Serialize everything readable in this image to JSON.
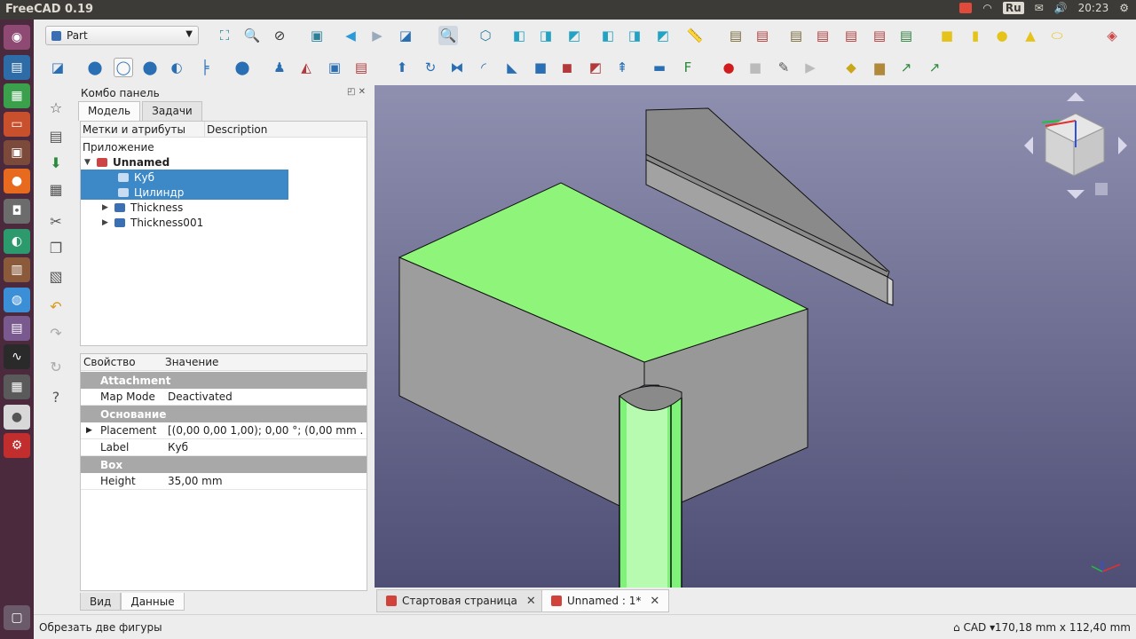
{
  "window": {
    "title": "FreeCAD 0.19",
    "time": "20:23",
    "keyboard": "Ru"
  },
  "workbench": {
    "selected": "Part"
  },
  "combo": {
    "title": "Комбо панель",
    "tabs": [
      "Модель",
      "Задачи"
    ],
    "tree_headers": [
      "Метки и атрибуты",
      "Description"
    ],
    "root_label": "Приложение",
    "document": "Unnamed",
    "items": [
      {
        "label": "Куб",
        "selected": true
      },
      {
        "label": "Цилиндр",
        "selected": true
      },
      {
        "label": "Thickness",
        "selected": false
      },
      {
        "label": "Thickness001",
        "selected": false
      }
    ],
    "prop_headers": [
      "Свойство",
      "Значение"
    ],
    "props": [
      {
        "type": "group",
        "name": "Attachment"
      },
      {
        "type": "prop",
        "name": "Map Mode",
        "value": "Deactivated"
      },
      {
        "type": "group",
        "name": "Основание"
      },
      {
        "type": "prop",
        "name": "Placement",
        "value": "[(0,00 0,00 1,00); 0,00 °; (0,00 mm  ..."
      },
      {
        "type": "prop",
        "name": "Label",
        "value": "Куб"
      },
      {
        "type": "group",
        "name": "Box"
      },
      {
        "type": "prop",
        "name": "Height",
        "value": "35,00 mm"
      }
    ],
    "bottom_tabs": [
      "Вид",
      "Данные"
    ]
  },
  "doc_tabs": [
    {
      "label": "Стартовая страница",
      "active": false
    },
    {
      "label": "Unnamed : 1*",
      "active": true
    }
  ],
  "status": {
    "message": "Обрезать две фигуры",
    "nav_style": "CAD",
    "dimensions": "170,18 mm x 112,40 mm"
  },
  "colors": {
    "selection": "#3d88c7",
    "highlight_green": "#8ef57a",
    "solid_gray": "#9d9d9d",
    "view_top": "#8f8fb0",
    "view_bottom": "#4f4f76"
  }
}
